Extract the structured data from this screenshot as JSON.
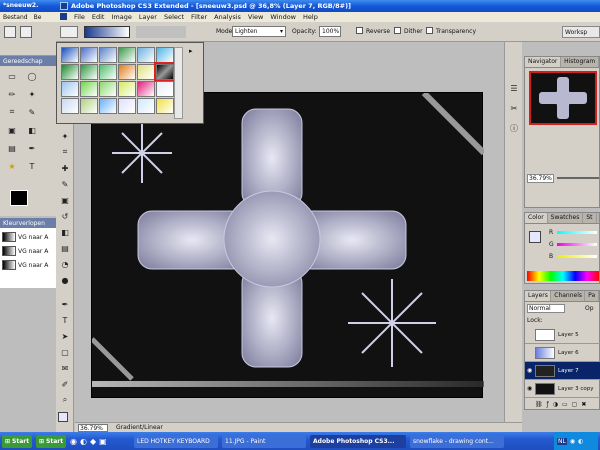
{
  "left_app": {
    "title": "*sneeuw2.",
    "menu_file": "Bestand",
    "menu_edit": "Be",
    "panel_title": "Gereedschap",
    "gradients_title": "Kleurverlopen",
    "gradient_items": [
      "VG naar A",
      "VG naar A",
      "VG naar A"
    ]
  },
  "titlebar": {
    "text": "Adobe Photoshop CS3 Extended - [sneeuw3.psd @ 36,8% (Layer 7, RGB/8#)]"
  },
  "menu": [
    "File",
    "Edit",
    "Image",
    "Layer",
    "Select",
    "Filter",
    "Analysis",
    "View",
    "Window",
    "Help"
  ],
  "options": {
    "mode_label": "Mode:",
    "mode_value": "Lighten",
    "opacity_label": "Opacity:",
    "opacity_value": "100%",
    "reverse": "Reverse",
    "dither": "Dither",
    "transparency": "Transparency",
    "workspace": "Worksp"
  },
  "gradient_swatches": [
    "#1a4fbd",
    "#4a6fc8",
    "#5d84c9",
    "#3c9b4a",
    "#6fb0e0",
    "#4db3e6",
    "#1a8a2a",
    "#2b9a3c",
    "#4fbf6a",
    "#e07b18",
    "#e0e080",
    "#333333",
    "#9cc3ee",
    "#6fd64a",
    "#8ad86f",
    "#d5ea5f",
    "#e0207a",
    "#e8eef8",
    "#c8d8f0",
    "#b0d080",
    "#6ab0ff",
    "#e0e0ff",
    "#d0e8ff",
    "#f0e040"
  ],
  "navigator": {
    "tab1": "Navigator",
    "tab2": "Histogram",
    "zoom": "36.79%"
  },
  "color": {
    "tab1": "Color",
    "tab2": "Swatches",
    "tab3": "St",
    "r": "R",
    "g": "G",
    "b": "B"
  },
  "layers": {
    "tab1": "Layers",
    "tab2": "Channels",
    "tab3": "Pa",
    "blend": "Normal",
    "blend2": "Op",
    "lock": "Lock:",
    "items": [
      "Layer 5",
      "Layer 6",
      "Layer 7",
      "Layer 3 copy"
    ]
  },
  "status": {
    "zoom": "36.79%",
    "info": "Gradient/Linear"
  },
  "taskbar": {
    "start1": "Start",
    "start2": "Start",
    "items": [
      "LED HOTKEY KEYBOARD",
      "11.JPG - Paint",
      "Adobe Photoshop CS3...",
      "snowflake - drawing cont..."
    ],
    "lang": "NL"
  },
  "colors": {
    "accent": "#1f5ed8",
    "selection": "#0a246a",
    "highlight_box": "#e02020"
  }
}
